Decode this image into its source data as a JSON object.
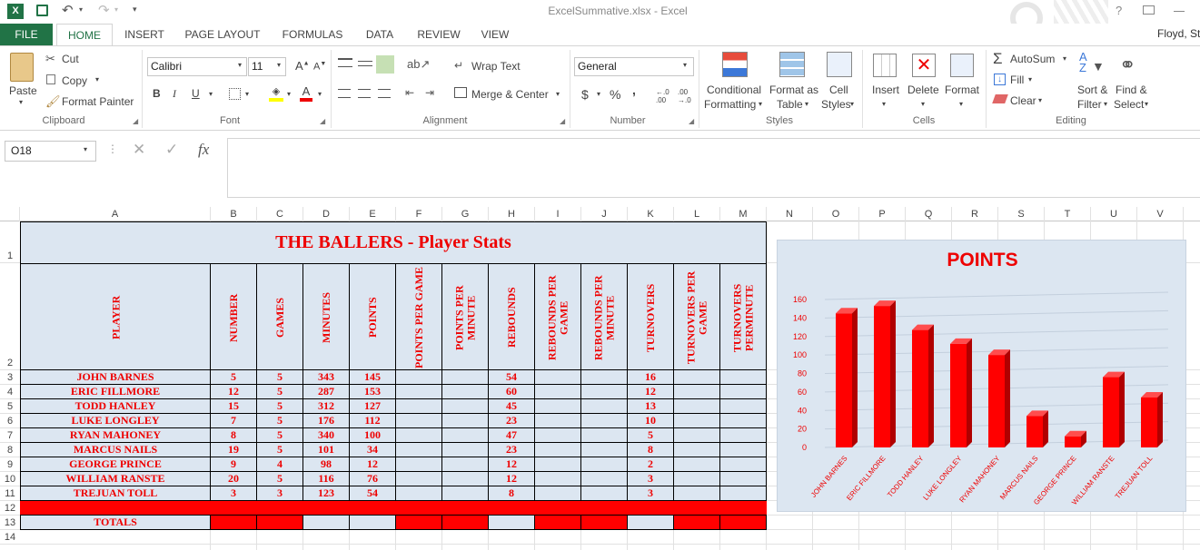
{
  "window": {
    "title": "ExcelSummative.xlsx - Excel",
    "user": "Floyd, St",
    "help": "?"
  },
  "tabs": [
    "FILE",
    "HOME",
    "INSERT",
    "PAGE LAYOUT",
    "FORMULAS",
    "DATA",
    "REVIEW",
    "VIEW"
  ],
  "clipboard": {
    "paste": "Paste",
    "cut": "Cut",
    "copy": "Copy",
    "format_painter": "Format Painter",
    "label": "Clipboard"
  },
  "font": {
    "name": "Calibri",
    "size": "11",
    "bold": "B",
    "italic": "I",
    "underline": "U",
    "label": "Font"
  },
  "alignment": {
    "wrap": "Wrap Text",
    "merge": "Merge & Center",
    "label": "Alignment"
  },
  "number": {
    "format": "General",
    "currency": "$",
    "percent": "%",
    "comma": ",",
    "label": "Number"
  },
  "styles": {
    "conditional": "Conditional",
    "conditional2": "Formatting",
    "format_table": "Format as",
    "format_table2": "Table",
    "cell_styles": "Cell",
    "cell_styles2": "Styles",
    "label": "Styles"
  },
  "cells": {
    "insert": "Insert",
    "delete": "Delete",
    "format": "Format",
    "label": "Cells"
  },
  "editing": {
    "autosum": "AutoSum",
    "fill": "Fill",
    "clear": "Clear",
    "sort": "Sort &",
    "sort2": "Filter",
    "find": "Find &",
    "find2": "Select",
    "label": "Editing"
  },
  "formula_bar": {
    "name_box": "O18",
    "fx": "fx",
    "value": ""
  },
  "columns": [
    "A",
    "B",
    "C",
    "D",
    "E",
    "F",
    "G",
    "H",
    "I",
    "J",
    "K",
    "L",
    "M",
    "N",
    "O",
    "P",
    "Q",
    "R",
    "S",
    "T",
    "U",
    "V"
  ],
  "rows": [
    "1",
    "2",
    "3",
    "4",
    "5",
    "6",
    "7",
    "8",
    "9",
    "10",
    "11",
    "12",
    "13",
    "14"
  ],
  "sheet": {
    "title": "THE BALLERS - Player Stats",
    "headers": [
      "PLAYER",
      "NUMBER",
      "GAMES",
      "MINUTES",
      "POINTS",
      "POINTS PER GAME",
      "POINTS PER MINUTE",
      "REBOUNDS",
      "REBOUNDS PER GAME",
      "REBOUNDS PER MINUTE",
      "TURNOVERS",
      "TURNOVERS PER GAME",
      "TURNOVERS PERMINUTE"
    ],
    "players": [
      {
        "name": "JOHN BARNES",
        "number": "5",
        "games": "5",
        "minutes": "343",
        "points": "145",
        "rebounds": "54",
        "turnovers": "16"
      },
      {
        "name": "ERIC FILLMORE",
        "number": "12",
        "games": "5",
        "minutes": "287",
        "points": "153",
        "rebounds": "60",
        "turnovers": "12"
      },
      {
        "name": "TODD HANLEY",
        "number": "15",
        "games": "5",
        "minutes": "312",
        "points": "127",
        "rebounds": "45",
        "turnovers": "13"
      },
      {
        "name": "LUKE LONGLEY",
        "number": "7",
        "games": "5",
        "minutes": "176",
        "points": "112",
        "rebounds": "23",
        "turnovers": "10"
      },
      {
        "name": "RYAN MAHONEY",
        "number": "8",
        "games": "5",
        "minutes": "340",
        "points": "100",
        "rebounds": "47",
        "turnovers": "5"
      },
      {
        "name": "MARCUS NAILS",
        "number": "19",
        "games": "5",
        "minutes": "101",
        "points": "34",
        "rebounds": "23",
        "turnovers": "8"
      },
      {
        "name": "GEORGE PRINCE",
        "number": "9",
        "games": "4",
        "minutes": "98",
        "points": "12",
        "rebounds": "12",
        "turnovers": "2"
      },
      {
        "name": "WILLIAM RANSTE",
        "number": "20",
        "games": "5",
        "minutes": "116",
        "points": "76",
        "rebounds": "12",
        "turnovers": "3"
      },
      {
        "name": "TREJUAN TOLL",
        "number": "3",
        "games": "3",
        "minutes": "123",
        "points": "54",
        "rebounds": "8",
        "turnovers": "3"
      }
    ],
    "totals_label": "TOTALS"
  },
  "chart_data": {
    "type": "bar",
    "title": "POINTS",
    "categories": [
      "JOHN BARNES",
      "ERIC FILLMORE",
      "TODD HANLEY",
      "LUKE LONGLEY",
      "RYAN MAHONEY",
      "MARCUS NAILS",
      "GEORGE PRINCE",
      "WILLIAM RANSTE",
      "TREJUAN TOLL"
    ],
    "values": [
      145,
      153,
      127,
      112,
      100,
      34,
      12,
      76,
      54
    ],
    "yticks": [
      0,
      20,
      40,
      60,
      80,
      100,
      120,
      140,
      160
    ],
    "ylim": [
      0,
      160
    ],
    "bar_color": "#ff0000",
    "grid": true
  },
  "colors": {
    "excel_green": "#217346",
    "header_fill": "#dce6f1",
    "red": "#ff0000"
  }
}
